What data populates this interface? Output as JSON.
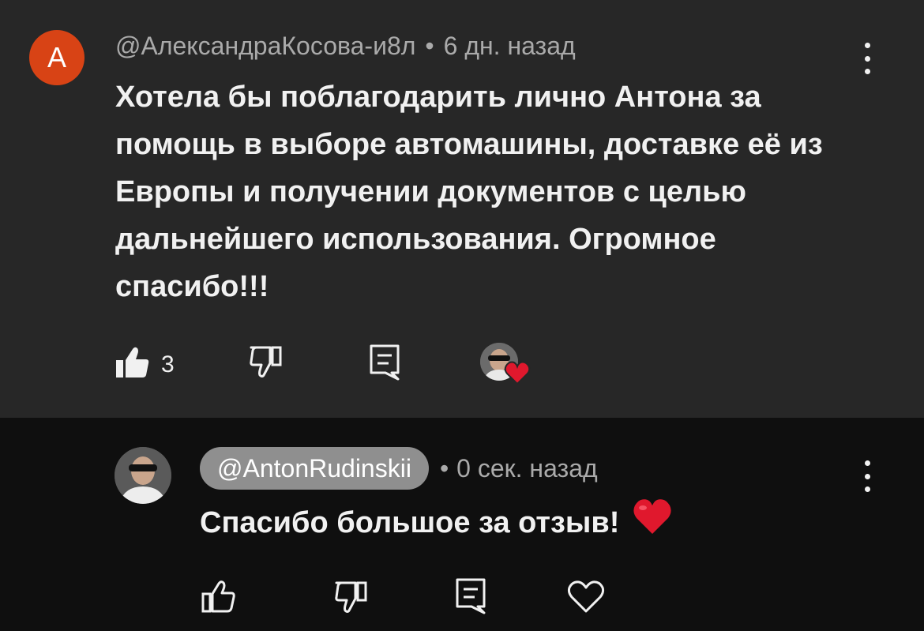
{
  "comment": {
    "avatar_letter": "A",
    "author": "@АлександраКосова-и8л",
    "separator": "•",
    "time": "6 дн. назад",
    "text": "Хотела бы поблагодарить лично Антона за помощь в выборе автомашины, доставке её из Европы и получении документов с целью дальнейшего использования. Огромное спасибо!!!",
    "like_count": "3",
    "icons": {
      "like": "thumb-up-filled-icon",
      "dislike": "thumb-down-icon",
      "reply": "comment-reply-icon",
      "creator_heart": "creator-heart-icon",
      "menu": "more-vertical-icon"
    }
  },
  "reply": {
    "author": "@AntonRudinskii",
    "separator": "•",
    "time": "0 сек. назад",
    "text": "Спасибо большое за отзыв!",
    "icons": {
      "like": "thumb-up-outline-icon",
      "dislike": "thumb-down-icon",
      "reply": "comment-reply-icon",
      "heart": "heart-outline-icon",
      "menu": "more-vertical-icon",
      "emoji": "red-heart-emoji"
    }
  },
  "colors": {
    "top_background": "#272727",
    "reply_background": "#0f0f0f",
    "avatar_orange": "#d84315",
    "secondary_text": "#aaaaaa",
    "author_pill": "#8f8f8f",
    "heart_red": "#e0182d"
  }
}
